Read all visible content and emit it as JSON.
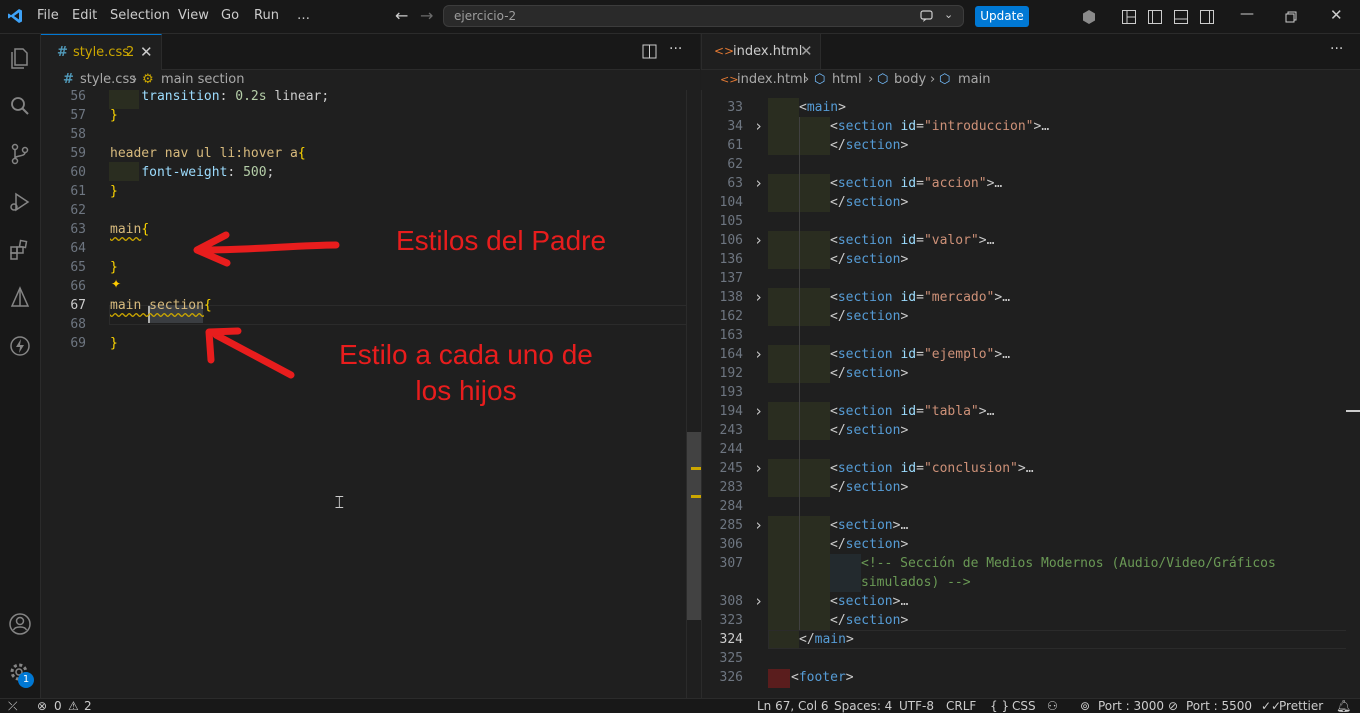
{
  "titlebar": {
    "menu": [
      "File",
      "Edit",
      "Selection",
      "View",
      "Go",
      "Run",
      "…"
    ],
    "search_text": "ejercicio-2",
    "update_label": "Update"
  },
  "left_editor": {
    "tab_label": "style.css",
    "tab_badge": "2",
    "breadcrumb_file": "style.css",
    "breadcrumb_symbol": "main section",
    "lines": [
      {
        "n": "56",
        "tokens": [
          [
            "    ",
            "k-punc"
          ],
          [
            "transition",
            "k-prop"
          ],
          [
            ": ",
            "k-punc"
          ],
          [
            "0.2s",
            "k-num"
          ],
          [
            " linear;",
            "k-punc"
          ]
        ]
      },
      {
        "n": "57",
        "tokens": [
          [
            "}",
            "k-br"
          ]
        ]
      },
      {
        "n": "58",
        "tokens": []
      },
      {
        "n": "59",
        "tokens": [
          [
            "header nav ul li:hover a",
            "k-sel"
          ],
          [
            "{",
            "k-br"
          ]
        ]
      },
      {
        "n": "60",
        "tokens": [
          [
            "    ",
            "k-punc"
          ],
          [
            "font-weight",
            "k-prop"
          ],
          [
            ": ",
            "k-punc"
          ],
          [
            "500",
            "k-num"
          ],
          [
            ";",
            "k-punc"
          ]
        ]
      },
      {
        "n": "61",
        "tokens": [
          [
            "}",
            "k-br"
          ]
        ]
      },
      {
        "n": "62",
        "tokens": []
      },
      {
        "n": "63",
        "tokens": [
          [
            "main",
            "k-sel wavy"
          ],
          [
            "{",
            "k-br"
          ]
        ]
      },
      {
        "n": "64",
        "tokens": []
      },
      {
        "n": "65",
        "tokens": [
          [
            "}",
            "k-br"
          ]
        ]
      },
      {
        "n": "66",
        "tokens": []
      },
      {
        "n": "67",
        "tokens": [
          [
            "main section",
            "k-sel wavy"
          ],
          [
            "{",
            "k-br"
          ]
        ]
      },
      {
        "n": "68",
        "tokens": []
      },
      {
        "n": "69",
        "tokens": [
          [
            "}",
            "k-br"
          ]
        ]
      }
    ],
    "current_line": "67",
    "annotation_1": "Estilos del Padre",
    "annotation_2_line1": "Estilo a cada uno de",
    "annotation_2_line2": "los hijos"
  },
  "right_editor": {
    "tab_label": "index.html",
    "breadcrumb": [
      "index.html",
      "html",
      "body",
      "main"
    ],
    "current_line": "324",
    "lines": [
      {
        "n": "33",
        "fold": false,
        "indent": 1,
        "tokens": [
          [
            "<",
            "k-punc"
          ],
          [
            "main",
            "k-tag"
          ],
          [
            ">",
            "k-punc"
          ]
        ]
      },
      {
        "n": "34",
        "fold": true,
        "indent": 2,
        "tokens": [
          [
            "<",
            "k-punc"
          ],
          [
            "section",
            "k-tag"
          ],
          [
            " ",
            "k-punc"
          ],
          [
            "id",
            "k-attr"
          ],
          [
            "=",
            "k-punc"
          ],
          [
            "\"introduccion\"",
            "k-str"
          ],
          [
            ">",
            "k-punc"
          ],
          [
            "…",
            "k-punc"
          ]
        ]
      },
      {
        "n": "61",
        "fold": false,
        "indent": 2,
        "tokens": [
          [
            "</",
            "k-punc"
          ],
          [
            "section",
            "k-tag"
          ],
          [
            ">",
            "k-punc"
          ]
        ]
      },
      {
        "n": "62",
        "fold": false,
        "indent": 0,
        "tokens": []
      },
      {
        "n": "63",
        "fold": true,
        "indent": 2,
        "tokens": [
          [
            "<",
            "k-punc"
          ],
          [
            "section",
            "k-tag"
          ],
          [
            " ",
            "k-punc"
          ],
          [
            "id",
            "k-attr"
          ],
          [
            "=",
            "k-punc"
          ],
          [
            "\"accion\"",
            "k-str"
          ],
          [
            ">",
            "k-punc"
          ],
          [
            "…",
            "k-punc"
          ]
        ]
      },
      {
        "n": "104",
        "fold": false,
        "indent": 2,
        "tokens": [
          [
            "</",
            "k-punc"
          ],
          [
            "section",
            "k-tag"
          ],
          [
            ">",
            "k-punc"
          ]
        ]
      },
      {
        "n": "105",
        "fold": false,
        "indent": 0,
        "tokens": []
      },
      {
        "n": "106",
        "fold": true,
        "indent": 2,
        "tokens": [
          [
            "<",
            "k-punc"
          ],
          [
            "section",
            "k-tag"
          ],
          [
            " ",
            "k-punc"
          ],
          [
            "id",
            "k-attr"
          ],
          [
            "=",
            "k-punc"
          ],
          [
            "\"valor\"",
            "k-str"
          ],
          [
            ">",
            "k-punc"
          ],
          [
            "…",
            "k-punc"
          ]
        ]
      },
      {
        "n": "136",
        "fold": false,
        "indent": 2,
        "tokens": [
          [
            "</",
            "k-punc"
          ],
          [
            "section",
            "k-tag"
          ],
          [
            ">",
            "k-punc"
          ]
        ]
      },
      {
        "n": "137",
        "fold": false,
        "indent": 0,
        "tokens": []
      },
      {
        "n": "138",
        "fold": true,
        "indent": 2,
        "tokens": [
          [
            "<",
            "k-punc"
          ],
          [
            "section",
            "k-tag"
          ],
          [
            " ",
            "k-punc"
          ],
          [
            "id",
            "k-attr"
          ],
          [
            "=",
            "k-punc"
          ],
          [
            "\"mercado\"",
            "k-str"
          ],
          [
            ">",
            "k-punc"
          ],
          [
            "…",
            "k-punc"
          ]
        ]
      },
      {
        "n": "162",
        "fold": false,
        "indent": 2,
        "tokens": [
          [
            "</",
            "k-punc"
          ],
          [
            "section",
            "k-tag"
          ],
          [
            ">",
            "k-punc"
          ]
        ]
      },
      {
        "n": "163",
        "fold": false,
        "indent": 0,
        "tokens": []
      },
      {
        "n": "164",
        "fold": true,
        "indent": 2,
        "tokens": [
          [
            "<",
            "k-punc"
          ],
          [
            "section",
            "k-tag"
          ],
          [
            " ",
            "k-punc"
          ],
          [
            "id",
            "k-attr"
          ],
          [
            "=",
            "k-punc"
          ],
          [
            "\"ejemplo\"",
            "k-str"
          ],
          [
            ">",
            "k-punc"
          ],
          [
            "…",
            "k-punc"
          ]
        ]
      },
      {
        "n": "192",
        "fold": false,
        "indent": 2,
        "tokens": [
          [
            "</",
            "k-punc"
          ],
          [
            "section",
            "k-tag"
          ],
          [
            ">",
            "k-punc"
          ]
        ]
      },
      {
        "n": "193",
        "fold": false,
        "indent": 0,
        "tokens": []
      },
      {
        "n": "194",
        "fold": true,
        "indent": 2,
        "tokens": [
          [
            "<",
            "k-punc"
          ],
          [
            "section",
            "k-tag"
          ],
          [
            " ",
            "k-punc"
          ],
          [
            "id",
            "k-attr"
          ],
          [
            "=",
            "k-punc"
          ],
          [
            "\"tabla\"",
            "k-str"
          ],
          [
            ">",
            "k-punc"
          ],
          [
            "…",
            "k-punc"
          ]
        ]
      },
      {
        "n": "243",
        "fold": false,
        "indent": 2,
        "tokens": [
          [
            "</",
            "k-punc"
          ],
          [
            "section",
            "k-tag"
          ],
          [
            ">",
            "k-punc"
          ]
        ]
      },
      {
        "n": "244",
        "fold": false,
        "indent": 0,
        "tokens": []
      },
      {
        "n": "245",
        "fold": true,
        "indent": 2,
        "tokens": [
          [
            "<",
            "k-punc"
          ],
          [
            "section",
            "k-tag"
          ],
          [
            " ",
            "k-punc"
          ],
          [
            "id",
            "k-attr"
          ],
          [
            "=",
            "k-punc"
          ],
          [
            "\"conclusion\"",
            "k-str"
          ],
          [
            ">",
            "k-punc"
          ],
          [
            "…",
            "k-punc"
          ]
        ]
      },
      {
        "n": "283",
        "fold": false,
        "indent": 2,
        "tokens": [
          [
            "</",
            "k-punc"
          ],
          [
            "section",
            "k-tag"
          ],
          [
            ">",
            "k-punc"
          ]
        ]
      },
      {
        "n": "284",
        "fold": false,
        "indent": 0,
        "tokens": []
      },
      {
        "n": "285",
        "fold": true,
        "indent": 2,
        "tokens": [
          [
            "<",
            "k-punc"
          ],
          [
            "section",
            "k-tag"
          ],
          [
            ">",
            "k-punc"
          ],
          [
            "…",
            "k-punc"
          ]
        ]
      },
      {
        "n": "306",
        "fold": false,
        "indent": 2,
        "tokens": [
          [
            "</",
            "k-punc"
          ],
          [
            "section",
            "k-tag"
          ],
          [
            ">",
            "k-punc"
          ]
        ]
      },
      {
        "n": "307",
        "fold": false,
        "indent": 3,
        "tokens": [
          [
            "<!-- Sección de Medios Modernos (Audio/Video/Gráficos",
            "k-com"
          ]
        ]
      },
      {
        "n": "",
        "fold": false,
        "indent": 3,
        "tokens": [
          [
            "simulados) -->",
            "k-com"
          ]
        ]
      },
      {
        "n": "308",
        "fold": true,
        "indent": 2,
        "tokens": [
          [
            "<",
            "k-punc"
          ],
          [
            "section",
            "k-tag"
          ],
          [
            ">",
            "k-punc"
          ],
          [
            "…",
            "k-punc"
          ]
        ]
      },
      {
        "n": "323",
        "fold": false,
        "indent": 2,
        "tokens": [
          [
            "</",
            "k-punc"
          ],
          [
            "section",
            "k-tag"
          ],
          [
            ">",
            "k-punc"
          ]
        ]
      },
      {
        "n": "324",
        "fold": false,
        "indent": 1,
        "tokens": [
          [
            "</",
            "k-punc"
          ],
          [
            "main",
            "k-tag"
          ],
          [
            ">",
            "k-punc"
          ]
        ]
      },
      {
        "n": "325",
        "fold": false,
        "indent": 0,
        "tokens": []
      },
      {
        "n": "326",
        "fold": false,
        "indent": 0,
        "tokens": [
          [
            "<",
            "k-punc"
          ],
          [
            "footer",
            "k-tag"
          ],
          [
            ">",
            "k-punc"
          ]
        ]
      }
    ]
  },
  "statusbar": {
    "errors": "0",
    "warnings": "2",
    "position": "Ln 67, Col 6",
    "spaces": "Spaces: 4",
    "encoding": "UTF-8",
    "eol": "CRLF",
    "language": "CSS",
    "port1": "Port : 3000",
    "port2": "Port : 5500",
    "prettier": "Prettier"
  },
  "accounts_badge": "1",
  "colors": {
    "accent": "#0078d4",
    "annotation": "#e81d1d"
  }
}
